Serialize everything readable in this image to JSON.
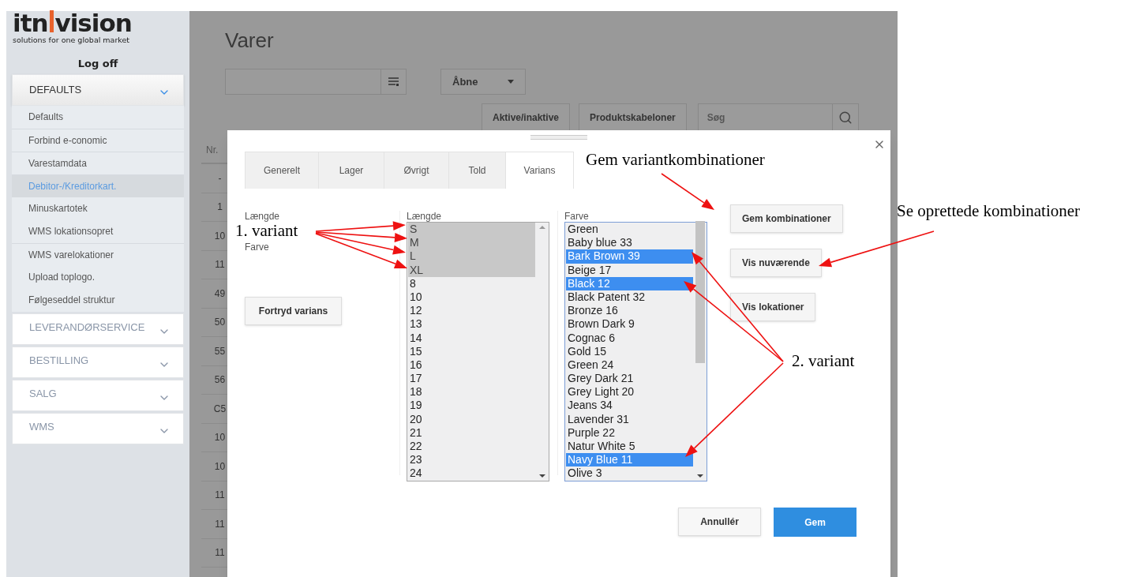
{
  "brand": {
    "left": "itn",
    "right": "vision",
    "tagline": "solutions for one global market"
  },
  "log_off": "Log off",
  "sidebar": {
    "sections": [
      {
        "label": "DEFAULTS",
        "expanded": true,
        "items": [
          {
            "label": "Defaults",
            "selected": false
          },
          {
            "label": "Forbind e-conomic",
            "selected": false
          },
          {
            "label": "Varestamdata",
            "selected": false
          },
          {
            "label": "Debitor-/Kreditorkart.",
            "selected": true
          },
          {
            "label": "Minuskartotek",
            "selected": false
          },
          {
            "label": "WMS lokationsopret",
            "selected": false
          },
          {
            "label": "WMS varelokationer",
            "selected": false
          },
          {
            "label": "Upload toplogo.",
            "selected": false
          },
          {
            "label": "Følgeseddel struktur",
            "selected": false
          }
        ]
      },
      {
        "label": "LEVERANDØRSERVICE",
        "expanded": false
      },
      {
        "label": "BESTILLING",
        "expanded": false
      },
      {
        "label": "SALG",
        "expanded": false
      },
      {
        "label": "WMS",
        "expanded": false
      }
    ]
  },
  "page": {
    "title": "Varer",
    "status_select": "Åbne",
    "buttons": [
      "Aktive/inaktive",
      "Produktskabeloner"
    ],
    "search": {
      "placeholder": "Søg"
    },
    "table": {
      "columns": [
        "Nr."
      ],
      "rows": [
        "-",
        "1",
        "10",
        "11",
        "49",
        "50",
        "55",
        "56",
        "C5",
        "10",
        "10",
        "11",
        "11",
        "11"
      ]
    }
  },
  "dialog": {
    "tabs": [
      {
        "label": "Generelt",
        "selected": false
      },
      {
        "label": "Lager",
        "selected": false
      },
      {
        "label": "Øvrigt",
        "selected": false
      },
      {
        "label": "Told",
        "selected": false
      },
      {
        "label": "Varians",
        "selected": true
      }
    ],
    "form_labels": [
      "Længde",
      "Farve"
    ],
    "undo_button": "Fortryd varians",
    "lists": [
      {
        "label": "Længde",
        "focused": false,
        "items": [
          {
            "label": "S",
            "selected": true
          },
          {
            "label": "M",
            "selected": true
          },
          {
            "label": "L",
            "selected": true
          },
          {
            "label": "XL",
            "selected": true
          },
          {
            "label": "8",
            "selected": false
          },
          {
            "label": "10",
            "selected": false
          },
          {
            "label": "12",
            "selected": false
          },
          {
            "label": "13",
            "selected": false
          },
          {
            "label": "14",
            "selected": false
          },
          {
            "label": "15",
            "selected": false
          },
          {
            "label": "16",
            "selected": false
          },
          {
            "label": "17",
            "selected": false
          },
          {
            "label": "18",
            "selected": false
          },
          {
            "label": "19",
            "selected": false
          },
          {
            "label": "20",
            "selected": false
          },
          {
            "label": "21",
            "selected": false
          },
          {
            "label": "22",
            "selected": false
          },
          {
            "label": "23",
            "selected": false
          },
          {
            "label": "24",
            "selected": false
          }
        ]
      },
      {
        "label": "Farve",
        "focused": true,
        "items": [
          {
            "label": "Green",
            "selected": false
          },
          {
            "label": "Baby blue 33",
            "selected": false
          },
          {
            "label": "Bark Brown 39",
            "selected": true
          },
          {
            "label": "Beige 17",
            "selected": false
          },
          {
            "label": "Black 12",
            "selected": true
          },
          {
            "label": "Black Patent 32",
            "selected": false
          },
          {
            "label": "Bronze 16",
            "selected": false
          },
          {
            "label": "Brown Dark 9",
            "selected": false
          },
          {
            "label": "Cognac 6",
            "selected": false
          },
          {
            "label": "Gold 15",
            "selected": false
          },
          {
            "label": "Green 24",
            "selected": false
          },
          {
            "label": "Grey Dark 21",
            "selected": false
          },
          {
            "label": "Grey Light 20",
            "selected": false
          },
          {
            "label": "Jeans 34",
            "selected": false
          },
          {
            "label": "Lavender 31",
            "selected": false
          },
          {
            "label": "Purple 22",
            "selected": false
          },
          {
            "label": "Natur White 5",
            "selected": false
          },
          {
            "label": "Navy Blue 11",
            "selected": true
          },
          {
            "label": "Olive 3",
            "selected": false
          }
        ]
      }
    ],
    "side_buttons": [
      "Gem kombinationer",
      "Vis nuværende",
      "Vis lokationer"
    ],
    "cancel": "Annullér",
    "save": "Gem"
  },
  "annotations": [
    {
      "text": "Gem variantkombinationer"
    },
    {
      "text": "Se oprettede kombinationer"
    },
    {
      "text": "1. variant"
    },
    {
      "text": "2. variant"
    }
  ]
}
